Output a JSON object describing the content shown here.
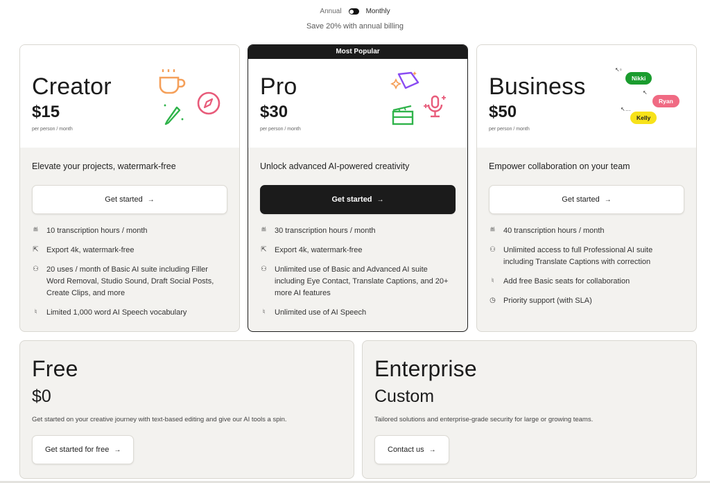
{
  "billing": {
    "annual_label": "Annual",
    "monthly_label": "Monthly",
    "save_note": "Save 20% with annual billing"
  },
  "plans": {
    "creator": {
      "name": "Creator",
      "price": "$15",
      "per": "per person / month",
      "tagline": "Elevate your projects, watermark-free",
      "cta": "Get started",
      "features": [
        {
          "icon": "transcript-icon",
          "text": "10 transcription hours / month"
        },
        {
          "icon": "export-icon",
          "text": "Export 4k, watermark-free"
        },
        {
          "icon": "ai-suite-icon",
          "text": "20 uses / month of Basic AI suite including Filler Word Removal, Studio Sound, Draft Social Posts, Create Clips, and more"
        },
        {
          "icon": "speech-icon",
          "text": "Limited 1,000 word AI Speech vocabulary"
        }
      ]
    },
    "pro": {
      "banner": "Most Popular",
      "name": "Pro",
      "price": "$30",
      "per": "per person / month",
      "tagline": "Unlock advanced AI-powered creativity",
      "cta": "Get started",
      "features": [
        {
          "icon": "transcript-icon",
          "text": "30 transcription hours / month"
        },
        {
          "icon": "export-icon",
          "text": "Export 4k, watermark-free"
        },
        {
          "icon": "ai-suite-icon",
          "text": "Unlimited use of Basic and Advanced AI suite including Eye Contact, Translate Captions, and 20+ more AI features"
        },
        {
          "icon": "speech-icon",
          "text": "Unlimited use of AI Speech"
        }
      ]
    },
    "business": {
      "name": "Business",
      "price": "$50",
      "per": "per person / month",
      "tagline": "Empower collaboration on your team",
      "cta": "Get started",
      "pills": [
        "Nikki",
        "Ryan",
        "Kelly"
      ],
      "features": [
        {
          "icon": "transcript-icon",
          "text": "40 transcription hours / month"
        },
        {
          "icon": "ai-suite-icon",
          "text": "Unlimited access to full Professional AI suite including Translate Captions with correction"
        },
        {
          "icon": "speech-icon",
          "text": "Add free Basic seats for collaboration"
        },
        {
          "icon": "clock-icon",
          "text": "Priority support (with SLA)"
        }
      ]
    },
    "free": {
      "name": "Free",
      "price": "$0",
      "desc": "Get started on your creative journey with text-based editing and give our AI tools a spin.",
      "cta": "Get started for free"
    },
    "enterprise": {
      "name": "Enterprise",
      "price": "Custom",
      "desc": "Tailored solutions and enterprise-grade security for large or growing teams.",
      "cta": "Contact us"
    }
  },
  "colors": {
    "dark": "#1b1b1b",
    "card_bg": "#f3f2ef",
    "nikki": "#1a9c2e",
    "ryan": "#f06a83",
    "kelly": "#f7e21a",
    "orange": "#f5a05a",
    "green": "#2fb34a",
    "pink": "#e85b7a",
    "purple": "#8a4bf2"
  }
}
